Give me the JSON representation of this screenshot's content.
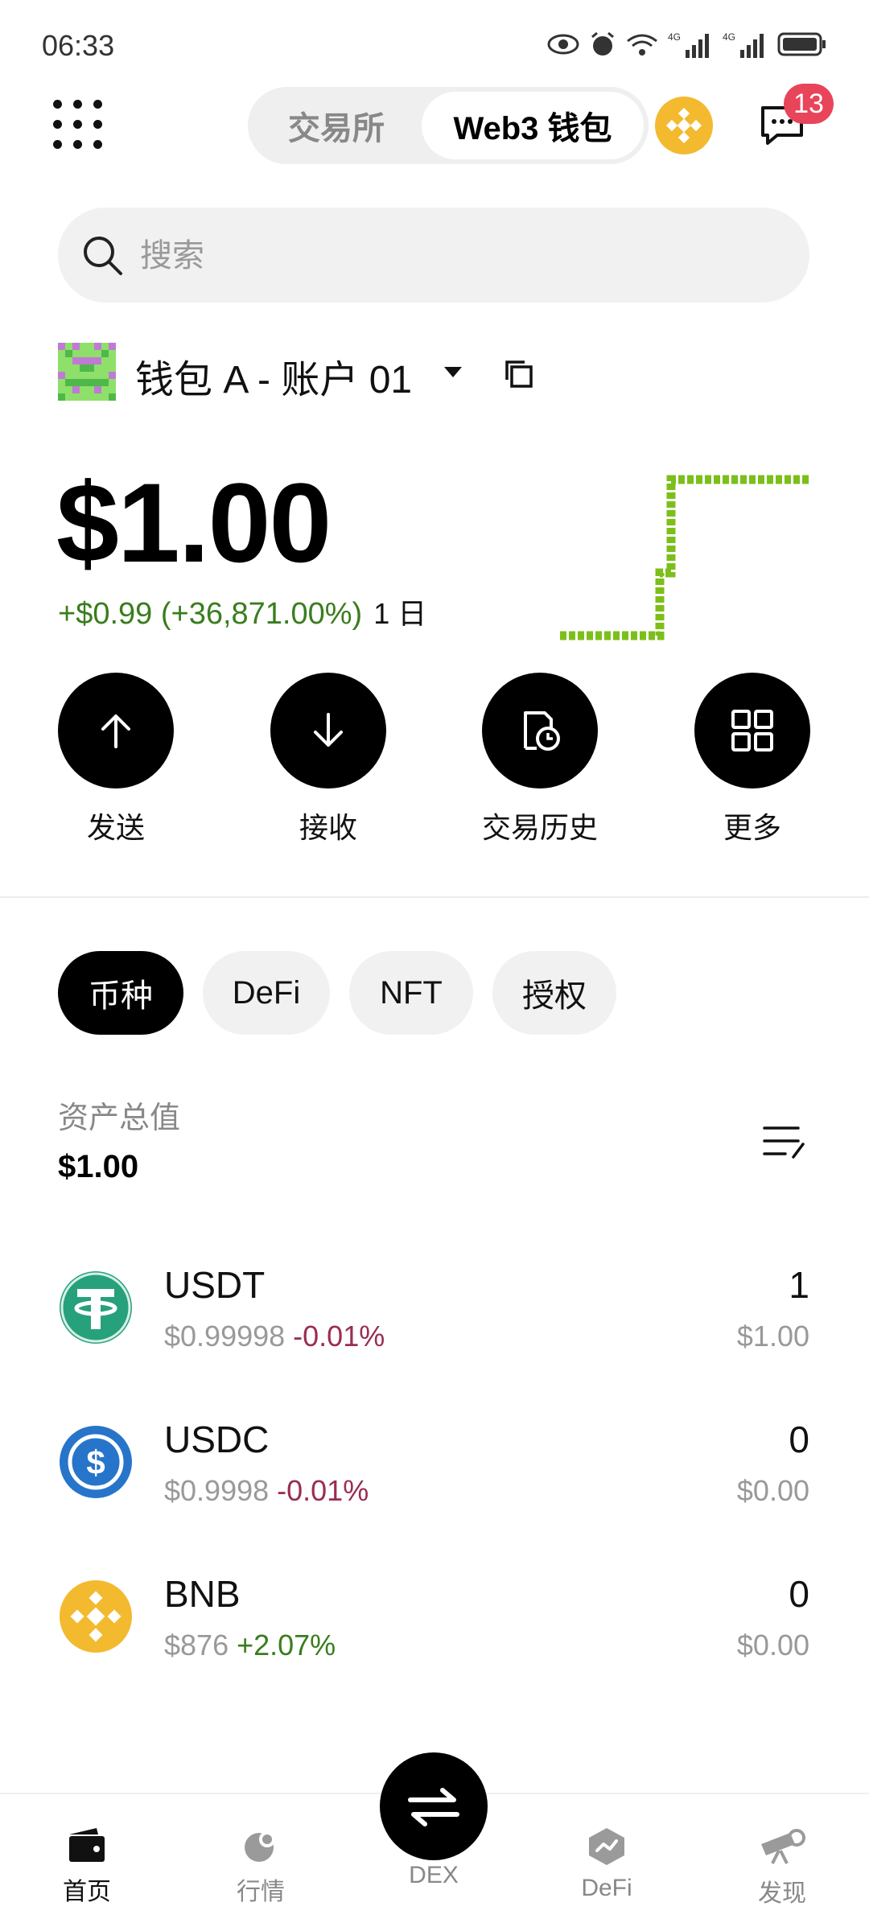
{
  "status_bar": {
    "time": "06:33"
  },
  "header": {
    "tabs": [
      "交易所",
      "Web3 钱包"
    ],
    "active_tab": "Web3 钱包",
    "notification_count": "13"
  },
  "search": {
    "placeholder": "搜索"
  },
  "account": {
    "name": "钱包 A - 账户 01"
  },
  "balance": {
    "value": "$1.00",
    "change": "+$0.99 (+36,871.00%)",
    "period": "1 日"
  },
  "actions": [
    {
      "label": "发送",
      "icon": "arrow-up-icon"
    },
    {
      "label": "接收",
      "icon": "arrow-down-icon"
    },
    {
      "label": "交易历史",
      "icon": "history-icon"
    },
    {
      "label": "更多",
      "icon": "grid-icon"
    }
  ],
  "filters": [
    {
      "label": "币种",
      "active": true
    },
    {
      "label": "DeFi",
      "active": false
    },
    {
      "label": "NFT",
      "active": false
    },
    {
      "label": "授权",
      "active": false
    }
  ],
  "assets_total": {
    "label": "资产总值",
    "value": "$1.00"
  },
  "assets": [
    {
      "symbol": "USDT",
      "price": "$0.99998",
      "change": "-0.01%",
      "direction": "down",
      "quantity": "1",
      "value": "$1.00",
      "color": "#26A17B"
    },
    {
      "symbol": "USDC",
      "price": "$0.9998",
      "change": "-0.01%",
      "direction": "down",
      "quantity": "0",
      "value": "$0.00",
      "color": "#2775CA"
    },
    {
      "symbol": "BNB",
      "price": "$876",
      "change": "+2.07%",
      "direction": "up",
      "quantity": "0",
      "value": "$0.00",
      "color": "#F3BA2F"
    }
  ],
  "bottom_nav": [
    {
      "label": "首页",
      "active": true
    },
    {
      "label": "行情",
      "active": false
    },
    {
      "label": "DEX",
      "active": false
    },
    {
      "label": "DeFi",
      "active": false
    },
    {
      "label": "发现",
      "active": false
    }
  ],
  "colors": {
    "positive": "#3a7d1e",
    "negative": "#9a2d52",
    "badge": "#e8445a",
    "sparkline": "#7cbf1a"
  }
}
